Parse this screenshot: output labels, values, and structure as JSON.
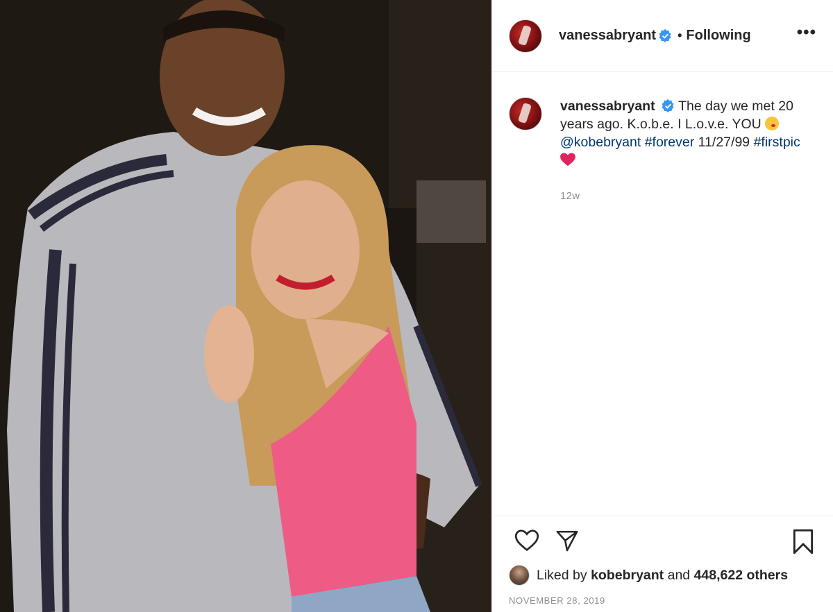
{
  "header": {
    "username": "vanessabryant",
    "separator": "•",
    "follow_label": "Following",
    "more_label": "•••"
  },
  "caption": {
    "username": "vanessabryant",
    "text_1": "The day we met 20 years ago. K.o.b.e. I L.o.v.e. YOU",
    "mention": "@kobebryant",
    "hashtag_1": "#forever",
    "date_text": "11/27/99",
    "hashtag_2": "#firstpic",
    "time_ago": "12w"
  },
  "engagement": {
    "liked_prefix": "Liked by",
    "liked_user": "kobebryant",
    "liked_and": "and",
    "liked_count": "448,622 others",
    "post_date": "NOVEMBER 28, 2019"
  },
  "icons": {
    "verified": "verified-badge-icon",
    "like": "heart-outline-icon",
    "share": "paper-plane-icon",
    "save": "bookmark-icon",
    "kiss_emoji": "face-blowing-kiss-emoji",
    "heart_emoji": "red-heart-emoji"
  },
  "colors": {
    "link": "#00376b",
    "verified": "#3897f0",
    "muted": "#8e8e8e",
    "text": "#262626"
  }
}
